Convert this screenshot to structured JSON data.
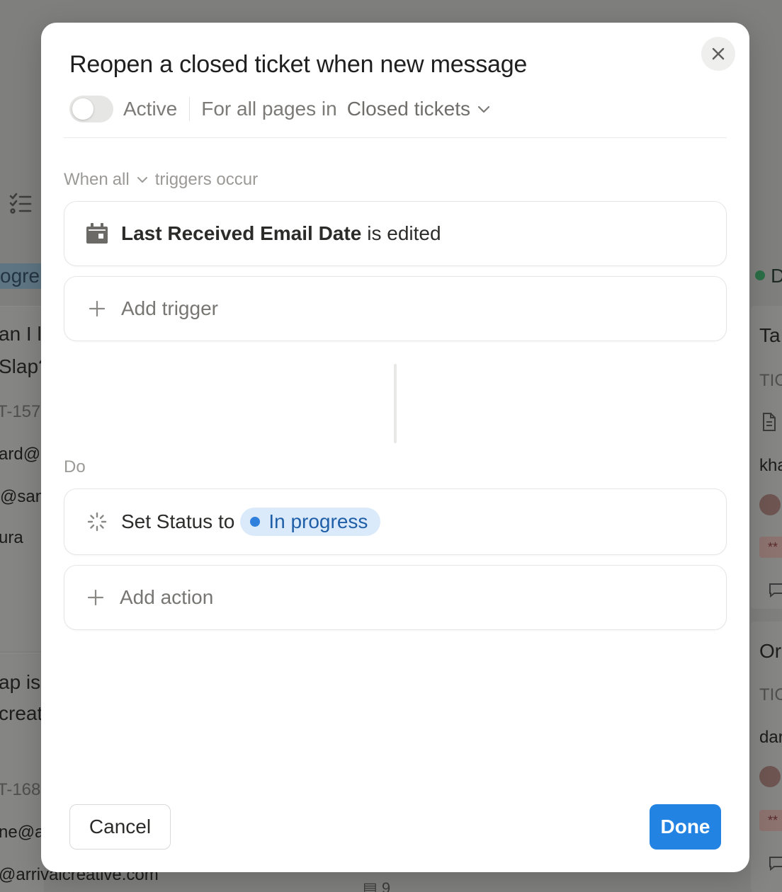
{
  "background": {
    "left_column": {
      "group_tag": "ogre",
      "card1_title_line1": "an I l",
      "card1_title_line2": "Slap?",
      "card1_id": "T-157",
      "card1_email": "ard@",
      "card1_handle": "@san",
      "card1_name": "ura",
      "card2_title_line1": "ap is",
      "card2_title_line2": "creat",
      "card2_id": "T-168",
      "card2_email": "ne@a",
      "card2_email_full": "@arrivalcreative.com"
    },
    "right_column": {
      "group_tag": "D",
      "card1_title": "Ta",
      "card1_prefix": "TIC",
      "card1_user": "kha",
      "card1_pill": "**",
      "card2_title": "Or",
      "card2_prefix": "TIC",
      "card2_user": "dar",
      "card2_pill": "**"
    },
    "bottom_comment_count": "9"
  },
  "modal": {
    "title": "Reopen a closed ticket when new message",
    "active_label": "Active",
    "active_on": false,
    "pages_label": "For all pages in",
    "database_name": "Closed tickets",
    "triggers_section": {
      "prefix": "When",
      "mode": "all",
      "suffix": "triggers occur"
    },
    "trigger": {
      "property": "Last Received Email Date",
      "condition": "is edited",
      "icon": "calendar-icon"
    },
    "add_trigger_label": "Add trigger",
    "do_label": "Do",
    "action": {
      "text": "Set Status to",
      "status_value": "In progress",
      "status_color": "#2f7fdc",
      "icon": "loading-status-icon"
    },
    "add_action_label": "Add action",
    "cancel_label": "Cancel",
    "done_label": "Done",
    "accent_color": "#2383e2"
  }
}
